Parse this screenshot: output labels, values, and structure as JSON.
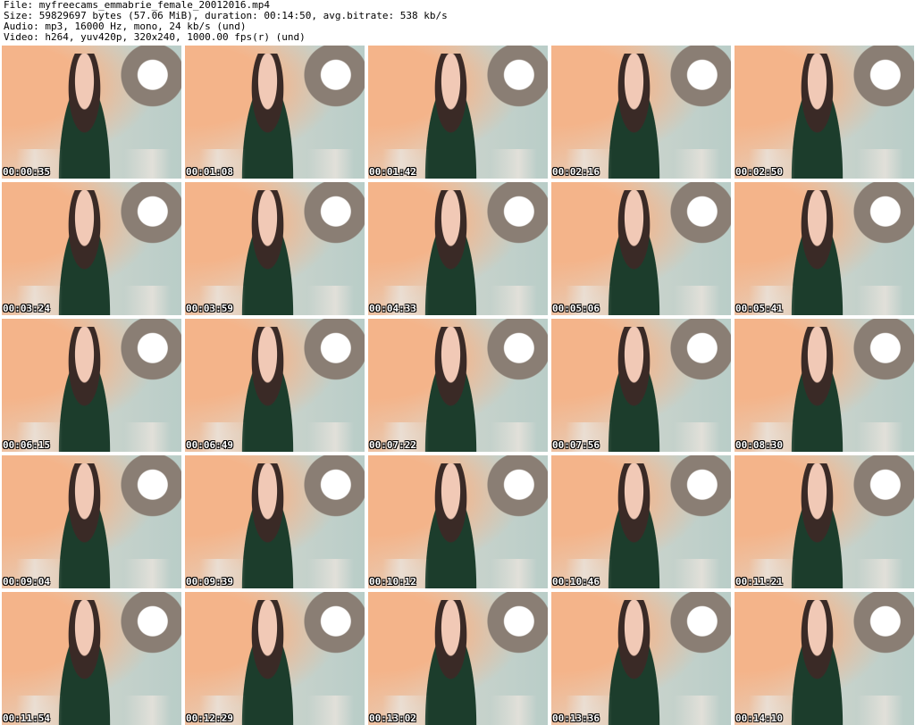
{
  "header": {
    "file": "File: myfreecams_emmabrie_female_20012016.mp4",
    "size": "Size: 59829697 bytes (57.06 MiB), duration: 00:14:50, avg.bitrate: 538 kb/s",
    "audio": "Audio: mp3, 16000 Hz, mono, 24 kb/s (und)",
    "video": "Video: h264, yuv420p, 320x240, 1000.00 fps(r) (und)"
  },
  "thumbnails": [
    {
      "time": "00:00:35"
    },
    {
      "time": "00:01:08"
    },
    {
      "time": "00:01:42"
    },
    {
      "time": "00:02:16"
    },
    {
      "time": "00:02:50"
    },
    {
      "time": "00:03:24"
    },
    {
      "time": "00:03:59"
    },
    {
      "time": "00:04:33"
    },
    {
      "time": "00:05:06"
    },
    {
      "time": "00:05:41"
    },
    {
      "time": "00:06:15"
    },
    {
      "time": "00:06:49"
    },
    {
      "time": "00:07:22"
    },
    {
      "time": "00:07:56"
    },
    {
      "time": "00:08:30"
    },
    {
      "time": "00:09:04"
    },
    {
      "time": "00:09:39"
    },
    {
      "time": "00:10:12"
    },
    {
      "time": "00:10:46"
    },
    {
      "time": "00:11:21"
    },
    {
      "time": "00:11:54"
    },
    {
      "time": "00:12:29"
    },
    {
      "time": "00:13:02"
    },
    {
      "time": "00:13:36"
    },
    {
      "time": "00:14:10"
    }
  ]
}
